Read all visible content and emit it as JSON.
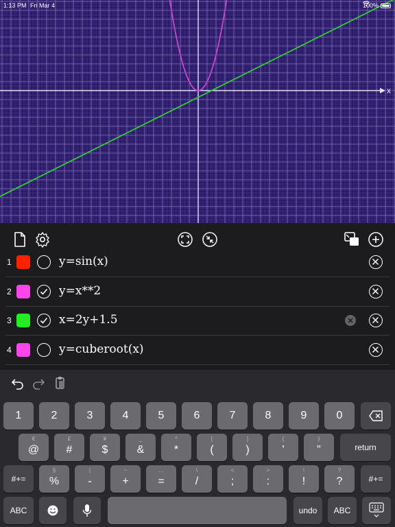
{
  "status": {
    "time": "1:13 PM",
    "date": "Fri Mar 4",
    "battery": "100%"
  },
  "graph": {
    "x_axis_label": "x",
    "background": "#241260",
    "visible_curves": [
      {
        "equation": "y=x**2",
        "color": "#cc44cc"
      },
      {
        "equation": "x=2y+1.5",
        "color": "#33cc33"
      }
    ]
  },
  "toolbar": {
    "left": [
      "new-document-icon",
      "settings-gear-icon"
    ],
    "center": [
      "fit-to-screen-icon",
      "zoom-to-point-icon"
    ],
    "right": [
      "switch-window-icon",
      "add-equation-icon"
    ]
  },
  "equations": [
    {
      "number": "1",
      "color": "#ff2200",
      "visible": false,
      "text": "y=sin(x)",
      "editing": false
    },
    {
      "number": "2",
      "color": "#ff44ee",
      "visible": true,
      "text": "y=x**2",
      "editing": false
    },
    {
      "number": "3",
      "color": "#22ee22",
      "visible": true,
      "text": "x=2y+1.5",
      "editing": true
    },
    {
      "number": "4",
      "color": "#ff44ee",
      "visible": false,
      "text": "y=cuberoot(x)",
      "editing": false
    }
  ],
  "keyboard": {
    "assistant": [
      "undo-icon",
      "redo-icon",
      "paste-icon"
    ],
    "row1": [
      "1",
      "2",
      "3",
      "4",
      "5",
      "6",
      "7",
      "8",
      "9",
      "0"
    ],
    "row2": [
      {
        "main": "@",
        "sub": "€"
      },
      {
        "main": "#",
        "sub": "£"
      },
      {
        "main": "$",
        "sub": "¥"
      },
      {
        "main": "&",
        "sub": "_"
      },
      {
        "main": "*",
        "sub": "^"
      },
      {
        "main": "(",
        "sub": "["
      },
      {
        "main": ")",
        "sub": "]"
      },
      {
        "main": "'",
        "sub": "{"
      },
      {
        "main": "\"",
        "sub": "}"
      }
    ],
    "return_label": "return",
    "shift_label": "#+=",
    "row3": [
      {
        "main": "%",
        "sub": "§"
      },
      {
        "main": "-",
        "sub": "|"
      },
      {
        "main": "+",
        "sub": "~"
      },
      {
        "main": "=",
        "sub": "…"
      },
      {
        "main": "/",
        "sub": "\\"
      },
      {
        "main": ";",
        "sub": "<"
      },
      {
        "main": ":",
        "sub": ">"
      },
      {
        "main": "!",
        "sub": "!"
      },
      {
        "main": "?",
        "sub": "?"
      }
    ],
    "abc_label": "ABC",
    "undo_label": "undo"
  }
}
